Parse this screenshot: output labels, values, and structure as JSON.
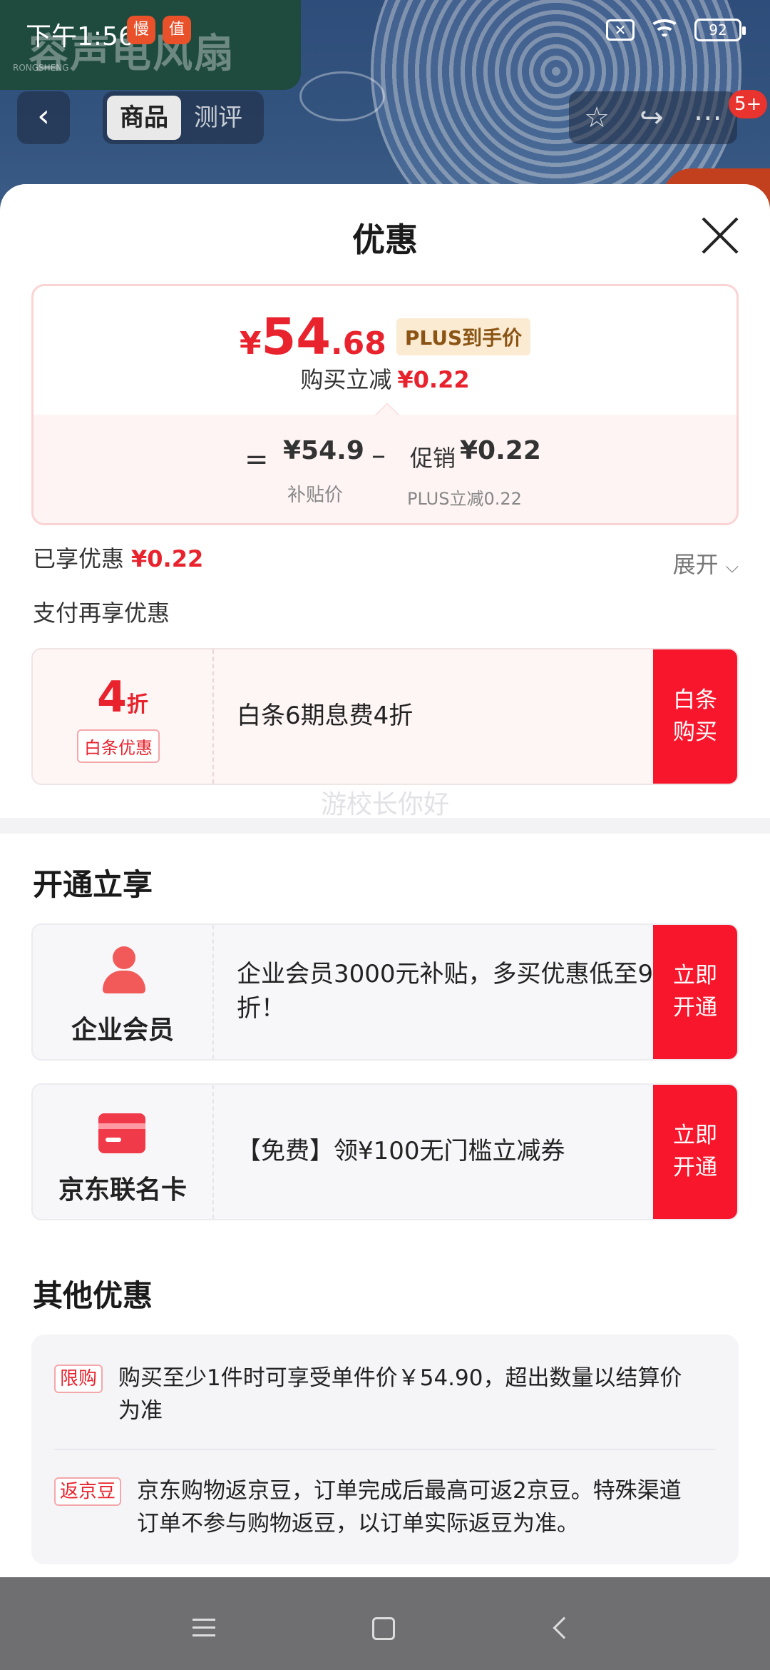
{
  "status_bar": {
    "time": "下午1:56",
    "app_icon_1": "慢",
    "app_icon_2": "值",
    "battery": "92"
  },
  "background": {
    "brand_text": "容声电风扇",
    "brand_sub": "RONGSHENG"
  },
  "nav": {
    "tabs": [
      "商品",
      "测评"
    ],
    "badge": "5+"
  },
  "sheet": {
    "title": "优惠"
  },
  "price": {
    "symbol": "¥",
    "integer": "54",
    "decimal": ".68",
    "plus_tag": "PLUS到手价",
    "sub_label": "购买立减",
    "sub_value": "¥0.22",
    "calc": {
      "equals": "=",
      "base_value": "¥54.9",
      "base_label": "补贴价",
      "minus": "–",
      "promo_prefix": "促销",
      "promo_value": "¥0.22",
      "promo_label": "PLUS立减0.22"
    }
  },
  "enjoyed": {
    "label": "已享优惠",
    "value": "¥0.22",
    "expand": "展开"
  },
  "pay_more": "支付再享优惠",
  "baitiao": {
    "discount_number": "4",
    "discount_unit": "折",
    "tag": "白条优惠",
    "text": "白条6期息费4折",
    "button": "白条\n购买"
  },
  "watermark": "游校长你好",
  "open_section": {
    "title": "开通立享",
    "items": [
      {
        "label": "企业会员",
        "text": "企业会员3000元补贴，多买优惠低至9折！",
        "button": "立即\n开通",
        "icon": "person-icon"
      },
      {
        "label": "京东联名卡",
        "text": "【免费】领¥100无门槛立减券",
        "button": "立即\n开通",
        "icon": "card-icon"
      }
    ]
  },
  "other_section": {
    "title": "其他优惠",
    "items": [
      {
        "tag": "限购",
        "text": "购买至少1件时可享受单件价￥54.90，超出数量以结算价为准"
      },
      {
        "tag": "返京豆",
        "text": "京东购物返京豆，订单完成后最高可返2京豆。特殊渠道订单不参与购物返豆，以订单实际返豆为准。"
      }
    ]
  },
  "colors": {
    "accent_red": "#f7162c",
    "price_red": "#e8232d",
    "plus_gold_bg": "#fbebd2"
  }
}
